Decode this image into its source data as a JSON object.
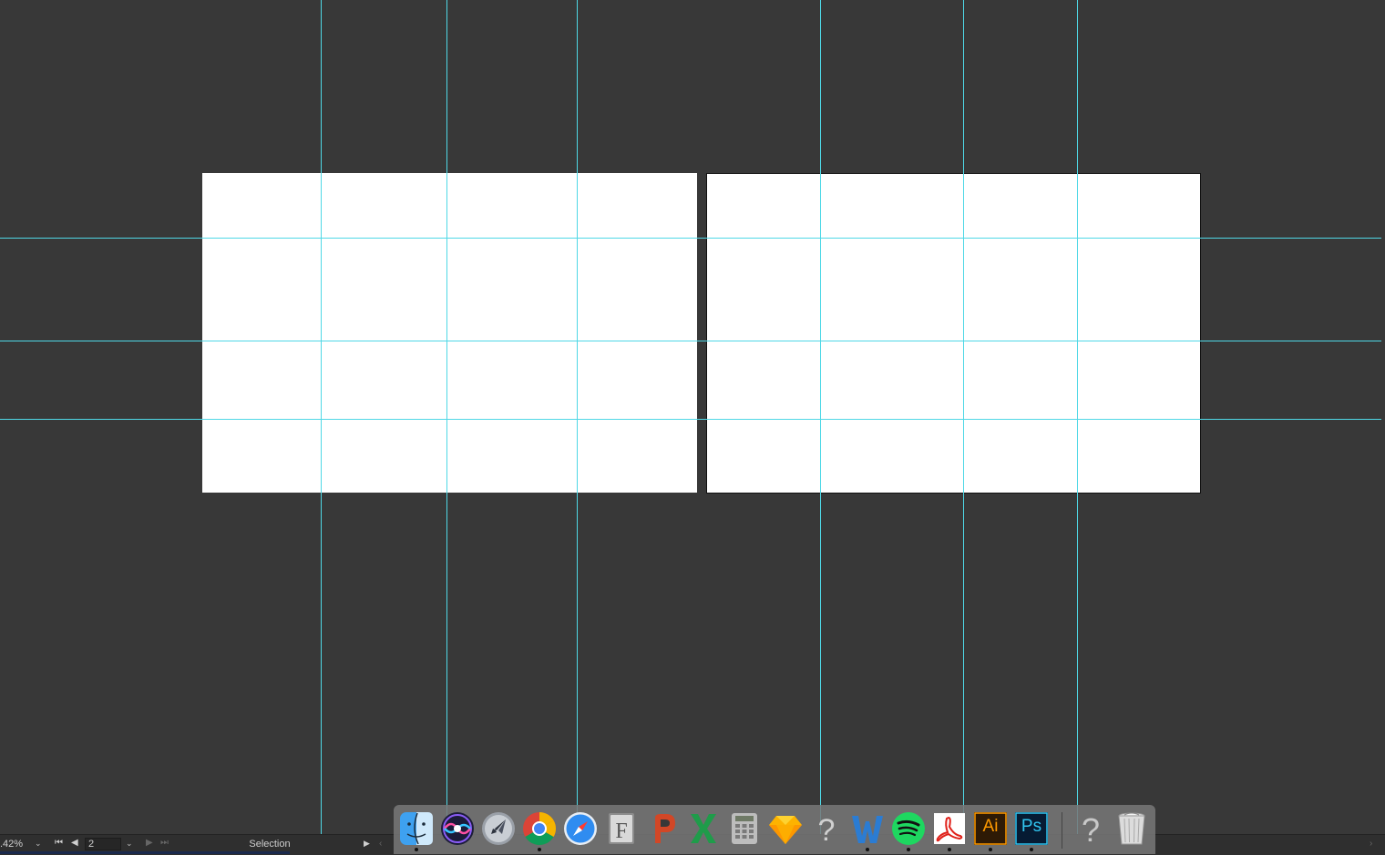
{
  "status_bar": {
    "zoom": ".42%",
    "page": "2",
    "tool": "Selection"
  },
  "dock": {
    "items": [
      {
        "name": "finder-icon",
        "running": true
      },
      {
        "name": "siri-icon",
        "running": false
      },
      {
        "name": "launchpad-icon",
        "running": false
      },
      {
        "name": "chrome-icon",
        "running": true
      },
      {
        "name": "safari-icon",
        "running": false
      },
      {
        "name": "fontbook-icon",
        "running": false
      },
      {
        "name": "powerpoint-icon",
        "running": false
      },
      {
        "name": "excel-icon",
        "running": false
      },
      {
        "name": "calculator-icon",
        "running": false
      },
      {
        "name": "sketch-icon",
        "running": false
      },
      {
        "name": "unknown-app-icon",
        "running": false
      },
      {
        "name": "word-icon",
        "running": true
      },
      {
        "name": "spotify-icon",
        "running": true
      },
      {
        "name": "acrobat-icon",
        "running": true
      },
      {
        "name": "illustrator-icon",
        "label": "Ai",
        "running": true
      },
      {
        "name": "photoshop-icon",
        "label": "Ps",
        "running": true
      },
      {
        "name": "unknown-folder-icon",
        "running": false
      },
      {
        "name": "trash-icon",
        "running": false
      }
    ]
  },
  "colors": {
    "canvas": "#383838",
    "guide": "#4fd8e6",
    "artboard": "#ffffff"
  }
}
